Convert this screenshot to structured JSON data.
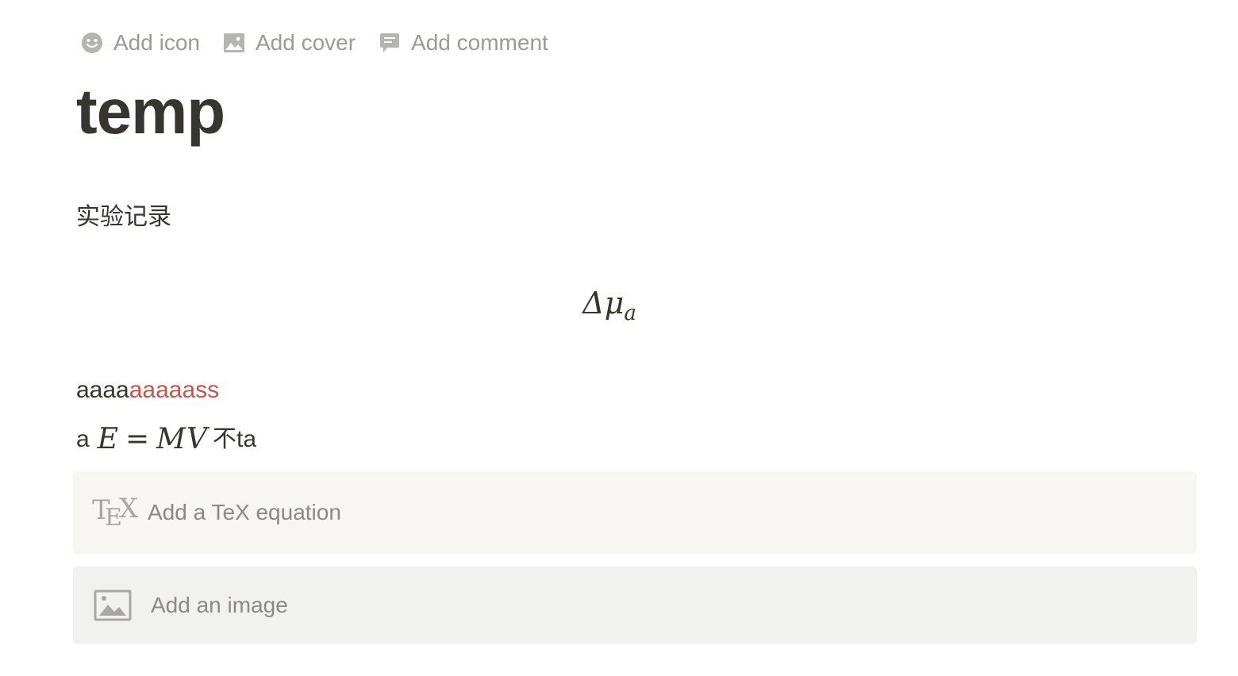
{
  "controls": {
    "add_icon": "Add icon",
    "add_cover": "Add cover",
    "add_comment": "Add comment"
  },
  "page": {
    "title": "temp"
  },
  "blocks": {
    "heading_cn": "实验记录",
    "equation": {
      "main": "Δμ",
      "subscript": "a"
    },
    "line_a": {
      "plain": "aaaa",
      "colored": "aaaaass",
      "colored_color": "#c4554d"
    },
    "line_b": {
      "prefix": "a",
      "math_lhs": "E",
      "math_op": "=",
      "math_rhs": "MV",
      "suffix_cn": "不",
      "suffix": "ta"
    },
    "tex_placeholder": {
      "logo": "TEX",
      "label": "Add a TeX equation"
    },
    "image_placeholder": {
      "label": "Add an image"
    }
  }
}
